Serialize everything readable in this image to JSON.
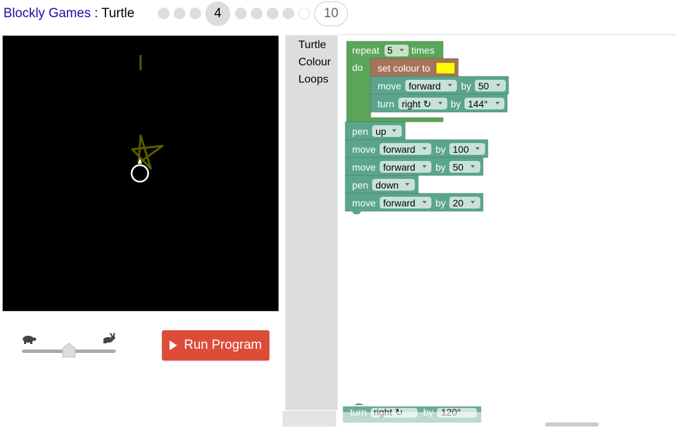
{
  "header": {
    "app_name": "Blockly Games",
    "separator": " : ",
    "game_name": "Turtle",
    "current_level": "4",
    "last_level": "10"
  },
  "toolbox": {
    "categories": [
      "Turtle",
      "Colour",
      "Loops"
    ]
  },
  "run_button": {
    "label": "Run Program",
    "color": "#dd4b39"
  },
  "speed_slider": {
    "value": 0.5
  },
  "blocks": {
    "repeat": {
      "label": "repeat",
      "count": "5",
      "suffix": "times",
      "do": "do"
    },
    "set_colour": {
      "label": "set colour to",
      "color": "#ffff00"
    },
    "move1": {
      "label": "move",
      "dir": "forward",
      "by": "by",
      "amount": "50"
    },
    "turn1": {
      "label": "turn",
      "dir": "right ↻",
      "by": "by",
      "amount": "144°"
    },
    "pen1": {
      "label": "pen",
      "state": "up"
    },
    "move2": {
      "label": "move",
      "dir": "forward",
      "by": "by",
      "amount": "100"
    },
    "move3": {
      "label": "move",
      "dir": "forward",
      "by": "by",
      "amount": "50"
    },
    "pen2": {
      "label": "pen",
      "state": "down"
    },
    "move4": {
      "label": "move",
      "dir": "forward",
      "by": "by",
      "amount": "20"
    },
    "hidden_turn": {
      "label": "turn",
      "dir": "right ↻",
      "by": "by",
      "amount": "120°"
    }
  },
  "colors": {
    "turtle_block": "#5ba58c",
    "loop_block": "#5ba55b",
    "colour_block": "#a5745b",
    "canvas": "#000000"
  }
}
